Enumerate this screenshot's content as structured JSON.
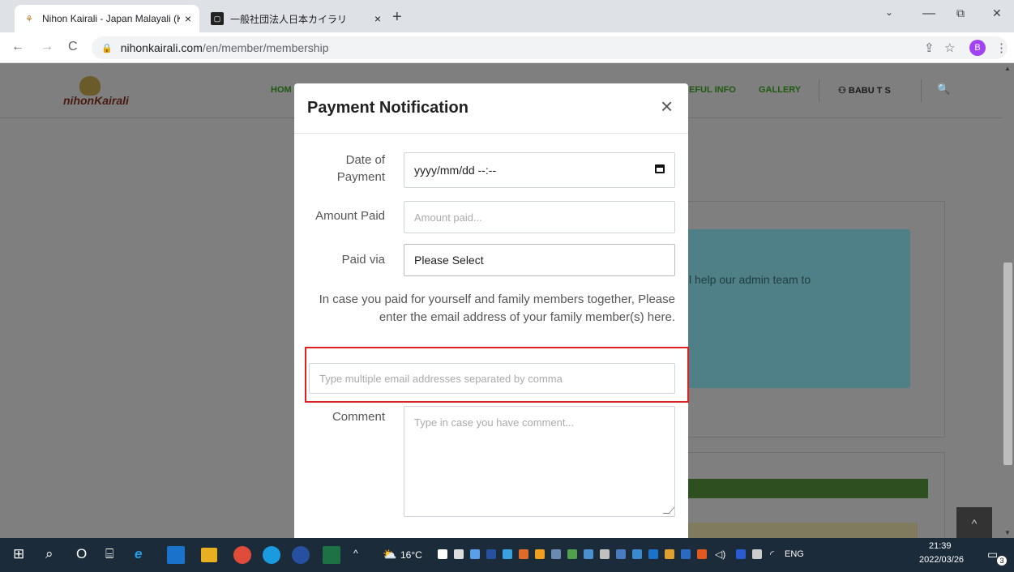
{
  "browser": {
    "tabs": [
      {
        "title": "Nihon Kairali - Japan Malayali (Ke",
        "close": "×",
        "favicon": "kairali-logo-icon"
      },
      {
        "title": "一般社団法人日本カイラリ",
        "close": "×",
        "favicon": "square-logo-icon"
      }
    ],
    "new_tab": "+",
    "window_controls": {
      "minimize": "—",
      "maximize": "⧉",
      "close": "✕",
      "tab_search": "⌄"
    },
    "nav": {
      "back": "←",
      "forward": "→",
      "reload": "C"
    },
    "url_host": "nihonkairali.com",
    "url_path": "/en/member/membership",
    "toolbar": {
      "share": "⇪",
      "bookmark": "☆",
      "sidepanel": "◧",
      "menu": "⋮"
    },
    "profile_initial": "B"
  },
  "site_nav": {
    "logo_text": "nihonKairali",
    "home_fragment": "HOM",
    "useful_info_fragment": "EFUL INFO",
    "gallery": "GALLERY",
    "user_name": "BABU T S",
    "search": "🔍"
  },
  "background": {
    "blue_notice_fragment": "l help our admin team to"
  },
  "modal": {
    "title": "Payment Notification",
    "close": "×",
    "date_label": "Date of Payment",
    "date_value": "yyyy/mm/dd --:--",
    "amount_label": "Amount Paid",
    "amount_placeholder": "Amount paid...",
    "paid_via_label": "Paid via",
    "paid_via_value": "Please Select",
    "family_note": "In case you paid for yourself and family members together, Please enter the email address of your family member(s) here.",
    "family_email_placeholder": "Type multiple email addresses separated by comma",
    "comment_label": "Comment",
    "comment_placeholder": "Type in case you have comment..."
  },
  "scroll_top": "^",
  "taskbar": {
    "start": "⊞",
    "search": "⌕",
    "task_view": "O",
    "widgets": "⌸",
    "chevron": "^",
    "weather": "16°C",
    "lang": "ENG",
    "time": "21:39",
    "date": "2022/03/26",
    "notification_count": "3"
  },
  "colors": {
    "overlay": "#7f7f7f",
    "accent_green": "#1e5a10",
    "highlight_red": "#e02020",
    "taskbar": "#1c2b3a"
  }
}
